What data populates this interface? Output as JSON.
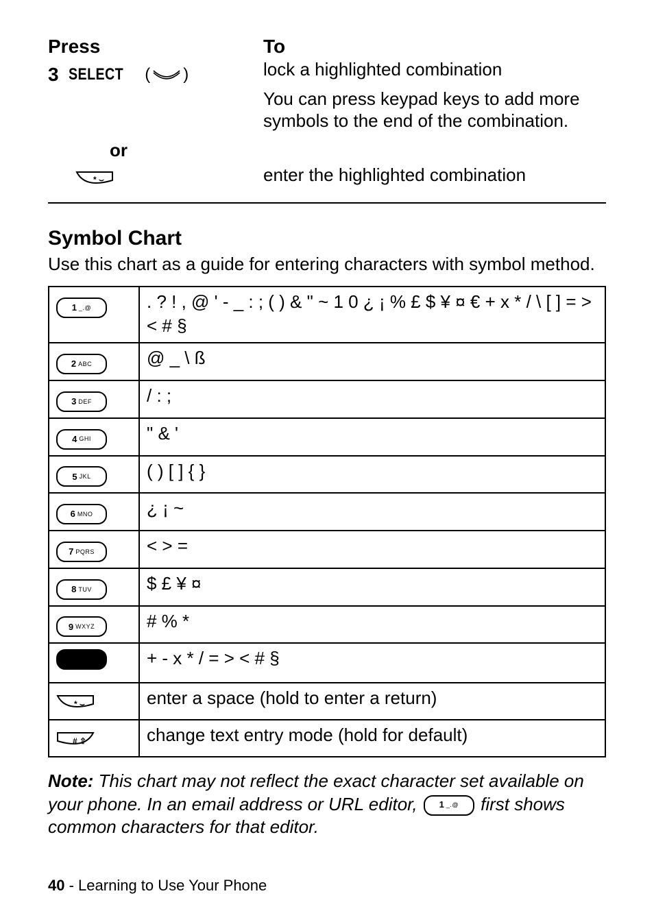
{
  "press_to": {
    "head_press": "Press",
    "head_to": "To",
    "step_number": "3",
    "step_label": "SELECT",
    "lock_text": "lock a highlighted combination",
    "extra_text": "You can press keypad keys to add more symbols to the end of the combination.",
    "or_label": "or",
    "enter_text": "enter the highlighted combination"
  },
  "section_heading": "Symbol Chart",
  "section_intro": "Use this chart as a guide for entering characters with symbol method.",
  "keys": {
    "k1_num": "1",
    "k1_sub": "_.@",
    "k2_num": "2",
    "k2_sub": "ABC",
    "k3_num": "3",
    "k3_sub": "DEF",
    "k4_num": "4",
    "k4_sub": "GHI",
    "k5_num": "5",
    "k5_sub": "JKL",
    "k6_num": "6",
    "k6_sub": "MNO",
    "k7_num": "7",
    "k7_sub": "PQRS",
    "k8_num": "8",
    "k8_sub": "TUV",
    "k9_num": "9",
    "k9_sub": "WXYZ",
    "kstar_label": "* ⌣",
    "khash_label": "# ⇧"
  },
  "chart_rows": {
    "r1": ". ? ! , @ ' - _ : ; ( ) & \" ~ 1 0 ¿ ¡ % £ $ ¥ ¤ € + x * / \\ [ ] = > < # §",
    "r2": "@ _ \\ ß",
    "r3": "/ : ;",
    "r4": "\" & '",
    "r5": "( ) [ ] { }",
    "r6": "¿ ¡ ~",
    "r7": "< > =",
    "r8": "$ £ ¥ ¤",
    "r9": "# % *",
    "r10": "+ - x * / = > < # §",
    "r11": "enter a space (hold to enter a return)",
    "r12": "change text entry mode (hold for default)"
  },
  "note": {
    "lead": "Note:",
    "before_key": "This chart may not reflect the exact character set available on your phone. In an email address or URL editor,",
    "after_key": "first shows common characters for that editor."
  },
  "footer": {
    "page_number": "40",
    "separator": " - ",
    "chapter": "Learning to Use Your Phone"
  }
}
